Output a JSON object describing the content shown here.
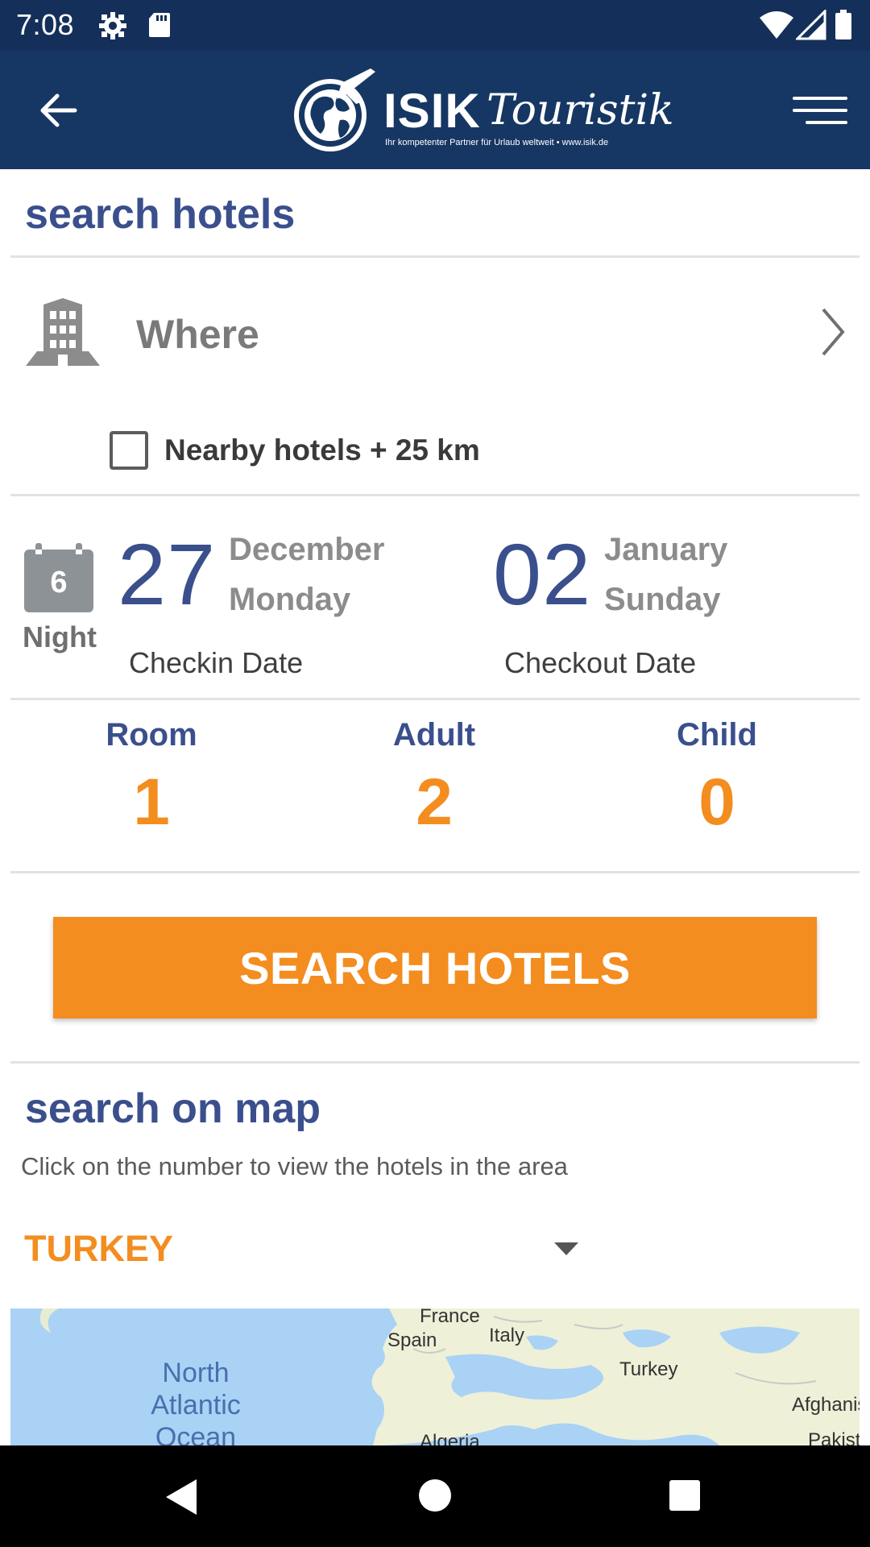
{
  "status_bar": {
    "time": "7:08",
    "icons": [
      "gear-icon",
      "sd-card-icon",
      "wifi-icon",
      "signal-icon",
      "battery-icon"
    ]
  },
  "app_bar": {
    "logo_brand": "ISIK",
    "logo_script": "Touristik",
    "logo_tagline": "Ihr kompetenter Partner für Urlaub weltweit • www.isik.de",
    "icons": [
      "back-arrow-icon",
      "menu-icon"
    ]
  },
  "search": {
    "title": "search hotels",
    "where_placeholder": "Where",
    "nearby_label": "Nearby hotels + 25 km",
    "nearby_checked": false,
    "nights": "6",
    "nights_label": "Night",
    "checkin": {
      "day": "27",
      "month": "December",
      "weekday": "Monday",
      "caption": "Checkin Date"
    },
    "checkout": {
      "day": "02",
      "month": "January",
      "weekday": "Sunday",
      "caption": "Checkout Date"
    },
    "room": {
      "label": "Room",
      "value": "1"
    },
    "adult": {
      "label": "Adult",
      "value": "2"
    },
    "child": {
      "label": "Child",
      "value": "0"
    },
    "button_label": "SEARCH HOTELS"
  },
  "map": {
    "title": "search on map",
    "hint": "Click on the number to view the hotels in the area",
    "country": "TURKEY",
    "labels": {
      "ocean": "North Atlantic Ocean",
      "france": "France",
      "spain": "Spain",
      "italy": "Italy",
      "turkey": "Turkey",
      "afghanistan": "Afghanis",
      "pakistan": "Pakist",
      "algeria": "Algeria"
    }
  },
  "colors": {
    "status_bar": "#14305a",
    "app_bar": "#163763",
    "accent": "#f38d1f",
    "primary_text": "#3a4f8c"
  }
}
